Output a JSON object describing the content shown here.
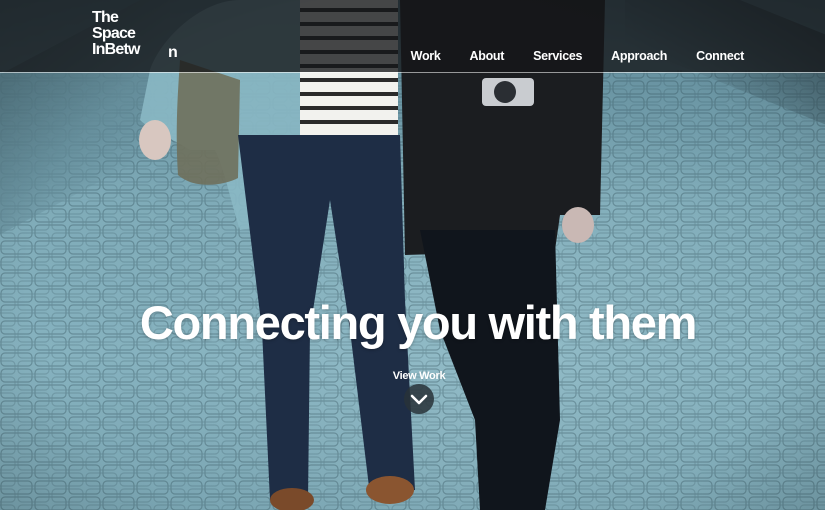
{
  "site": {
    "logo_lines": [
      "The",
      "Space",
      "InBetw"
    ],
    "logo_trailing": "n"
  },
  "nav": {
    "items": [
      {
        "label": "Work"
      },
      {
        "label": "About"
      },
      {
        "label": "Services"
      },
      {
        "label": "Approach"
      },
      {
        "label": "Connect"
      }
    ]
  },
  "hero": {
    "title": "Connecting you with them",
    "cta_label": "View Work",
    "cta_icon": "chevron-down-icon"
  },
  "colors": {
    "header_bg": "#141618",
    "text": "#ffffff",
    "photo_tint": "#7fabb8"
  }
}
